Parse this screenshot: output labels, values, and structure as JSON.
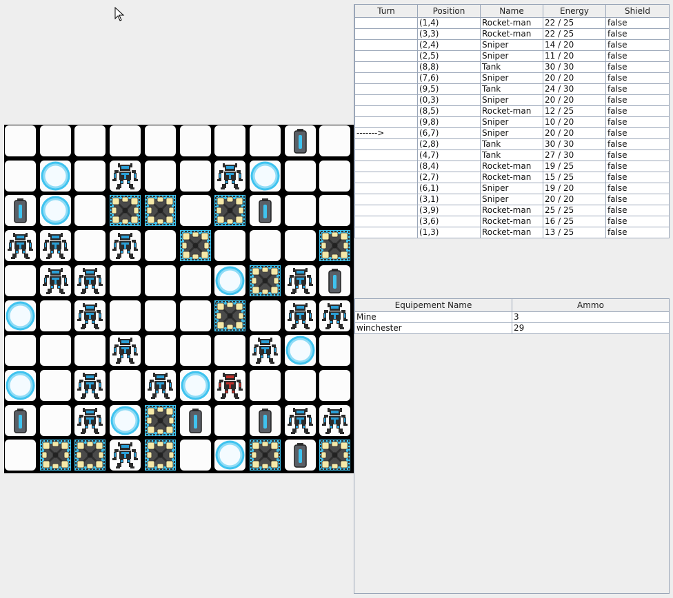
{
  "board": {
    "rows": [
      [
        "empty",
        "empty",
        "empty",
        "empty",
        "empty",
        "empty",
        "empty",
        "empty",
        "battery",
        "empty"
      ],
      [
        "empty",
        "orb",
        "empty",
        "robot",
        "empty",
        "empty",
        "robot",
        "orb",
        "empty",
        "empty"
      ],
      [
        "battery",
        "orb",
        "empty",
        "crate",
        "crate",
        "empty",
        "crate",
        "battery",
        "empty",
        "empty"
      ],
      [
        "robot",
        "robot",
        "empty",
        "robot",
        "empty",
        "crate",
        "empty",
        "empty",
        "empty",
        "crate"
      ],
      [
        "empty",
        "robot",
        "robot",
        "empty",
        "empty",
        "empty",
        "orb",
        "crate",
        "robot",
        "battery"
      ],
      [
        "orb",
        "empty",
        "robot",
        "empty",
        "empty",
        "empty",
        "crate",
        "empty",
        "robot",
        "robot"
      ],
      [
        "empty",
        "empty",
        "empty",
        "robot",
        "empty",
        "empty",
        "empty",
        "robot",
        "orb",
        "empty"
      ],
      [
        "orb",
        "empty",
        "robot",
        "empty",
        "robot",
        "orb",
        "robot-red",
        "empty",
        "empty",
        "empty"
      ],
      [
        "battery",
        "empty",
        "robot",
        "orb",
        "crate",
        "battery",
        "empty",
        "battery",
        "robot",
        "robot"
      ],
      [
        "empty",
        "crate",
        "crate",
        "robot",
        "crate",
        "empty",
        "orb",
        "crate",
        "battery",
        "crate"
      ]
    ]
  },
  "units_table": {
    "headers": [
      "Turn",
      "Position",
      "Name",
      "Energy",
      "Shield"
    ],
    "rows": [
      [
        "",
        "(1,4)",
        "Rocket-man",
        "22 / 25",
        "false"
      ],
      [
        "",
        "(3,3)",
        "Rocket-man",
        "22 / 25",
        "false"
      ],
      [
        "",
        "(2,4)",
        "Sniper",
        "14 / 20",
        "false"
      ],
      [
        "",
        "(2,5)",
        "Sniper",
        "11 / 20",
        "false"
      ],
      [
        "",
        "(8,8)",
        "Tank",
        "30 / 30",
        "false"
      ],
      [
        "",
        "(7,6)",
        "Sniper",
        "20 / 20",
        "false"
      ],
      [
        "",
        "(9,5)",
        "Tank",
        "24 / 30",
        "false"
      ],
      [
        "",
        "(0,3)",
        "Sniper",
        "20 / 20",
        "false"
      ],
      [
        "",
        "(8,5)",
        "Rocket-man",
        "12 / 25",
        "false"
      ],
      [
        "",
        "(9,8)",
        "Sniper",
        "10 / 20",
        "false"
      ],
      [
        "------->",
        "(6,7)",
        "Sniper",
        "20 / 20",
        "false"
      ],
      [
        "",
        "(2,8)",
        "Tank",
        "30 / 30",
        "false"
      ],
      [
        "",
        "(4,7)",
        "Tank",
        "27 / 30",
        "false"
      ],
      [
        "",
        "(8,4)",
        "Rocket-man",
        "19 / 25",
        "false"
      ],
      [
        "",
        "(2,7)",
        "Rocket-man",
        "15 / 25",
        "false"
      ],
      [
        "",
        "(6,1)",
        "Sniper",
        "19 / 20",
        "false"
      ],
      [
        "",
        "(3,1)",
        "Sniper",
        "20 / 20",
        "false"
      ],
      [
        "",
        "(3,9)",
        "Rocket-man",
        "25 / 25",
        "false"
      ],
      [
        "",
        "(3,6)",
        "Rocket-man",
        "16 / 25",
        "false"
      ],
      [
        "",
        "(1,3)",
        "Rocket-man",
        "13 / 25",
        "false"
      ]
    ]
  },
  "equipment_table": {
    "headers": [
      "Equipement Name",
      "Ammo"
    ],
    "rows": [
      [
        "Mine",
        "3"
      ],
      [
        "winchester",
        "29"
      ]
    ]
  },
  "colors": {
    "grid_border": "#9aa6b8",
    "board_line": "#000000",
    "orb": "#3fc3ef",
    "robot_accent": "#2a9fd6",
    "robot_red": "#c0302b",
    "crate": "#f5e9a8"
  }
}
